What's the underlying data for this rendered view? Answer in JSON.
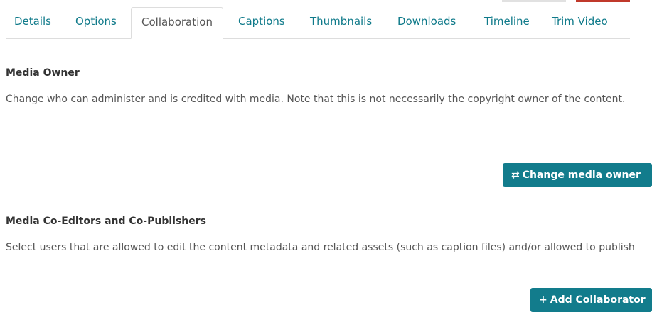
{
  "tabs": [
    {
      "label": "Details"
    },
    {
      "label": "Options"
    },
    {
      "label": "Collaboration"
    },
    {
      "label": "Captions"
    },
    {
      "label": "Thumbnails"
    },
    {
      "label": "Downloads"
    },
    {
      "label": "Timeline"
    },
    {
      "label": "Trim Video"
    }
  ],
  "active_tab": "Collaboration",
  "owner_section": {
    "title": "Media Owner",
    "description": "Change who can administer and is credited with media. Note that this is not necessarily the copyright owner of the content.",
    "button_label": "Change media owner",
    "button_icon": "swap-arrows-icon"
  },
  "coeditors_section": {
    "title": "Media Co-Editors and Co-Publishers",
    "description": "Select users that are allowed to edit the content metadata and related assets (such as caption files) and/or allowed to publish",
    "button_label": "Add Collaborator",
    "button_icon": "plus-icon"
  },
  "colors": {
    "accent": "#127c8c",
    "tab_link": "#0f7a8a"
  }
}
